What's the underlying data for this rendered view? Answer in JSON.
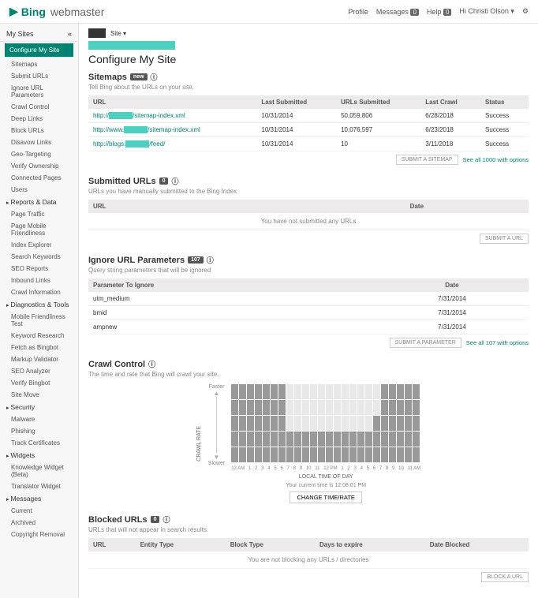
{
  "header": {
    "brand_a": "Bing",
    "brand_b": "webmaster",
    "profile": "Profile",
    "messages": "Messages",
    "messages_n": "0",
    "help": "Help",
    "help_n": "0",
    "user": "Hi Christi Olson ▾",
    "gear": "⚙"
  },
  "sidebar": {
    "head": "My Sites",
    "items": [
      {
        "l": "Configure My Site",
        "sel": true
      },
      {
        "l": "Sitemaps"
      },
      {
        "l": "Submit URLs"
      },
      {
        "l": "Ignore URL Parameters"
      },
      {
        "l": "Crawl Control"
      },
      {
        "l": "Deep Links"
      },
      {
        "l": "Block URLs"
      },
      {
        "l": "Disavow Links"
      },
      {
        "l": "Geo-Targeting"
      },
      {
        "l": "Verify Ownership"
      },
      {
        "l": "Connected Pages"
      },
      {
        "l": "Users"
      },
      {
        "l": "Reports & Data",
        "top": true,
        "arrow": true
      },
      {
        "l": "Page Traffic"
      },
      {
        "l": "Page Mobile Friendliness"
      },
      {
        "l": "Index Explorer"
      },
      {
        "l": "Search Keywords"
      },
      {
        "l": "SEO Reports"
      },
      {
        "l": "Inbound Links"
      },
      {
        "l": "Crawl Information"
      },
      {
        "l": "Diagnostics & Tools",
        "top": true,
        "arrow": true
      },
      {
        "l": "Mobile Friendliness Test"
      },
      {
        "l": "Keyword Research"
      },
      {
        "l": "Fetch as Bingbot"
      },
      {
        "l": "Markup Validator"
      },
      {
        "l": "SEO Analyzer"
      },
      {
        "l": "Verify Bingbot"
      },
      {
        "l": "Site Move"
      },
      {
        "l": "Security",
        "top": true,
        "arrow": true
      },
      {
        "l": "Malware"
      },
      {
        "l": "Phishing"
      },
      {
        "l": "Track Certificates"
      },
      {
        "l": "Widgets",
        "top": true,
        "arrow": true
      },
      {
        "l": "Knowledge Widget (Beta)"
      },
      {
        "l": "Translator Widget"
      },
      {
        "l": "Messages",
        "top": true,
        "arrow": true
      },
      {
        "l": "Current"
      },
      {
        "l": "Archived"
      },
      {
        "l": "Copyright Removal"
      }
    ]
  },
  "page": {
    "bc_site": "Site ▾",
    "title": "Configure My Site"
  },
  "sitemaps": {
    "title": "Sitemaps",
    "tag": "new",
    "sub": "Tell Bing about the URLs on your site.",
    "cols": [
      "URL",
      "Last Submitted",
      "URLs Submitted",
      "Last Crawl",
      "Status"
    ],
    "rows": [
      {
        "url": "http://▮▮▮▮▮▮▮▮/sitemap-index.xml",
        "ls": "10/31/2014",
        "us": "50,059,806",
        "lc": "6/28/2018",
        "st": "Success"
      },
      {
        "url": "http://www.▮▮▮▮▮▮▮▮/sitemap-index.xml",
        "ls": "10/31/2014",
        "us": "10,076,597",
        "lc": "6/23/2018",
        "st": "Success"
      },
      {
        "url": "http://blogs.▮▮▮▮▮▮▮▮/feed/",
        "ls": "10/31/2014",
        "us": "10",
        "lc": "3/11/2018",
        "st": "Success"
      }
    ],
    "btn": "SUBMIT A SITEMAP",
    "all": "See all 1000 with options"
  },
  "submitted": {
    "title": "Submitted URLs",
    "tag": "0",
    "sub": "URLs you have manually submitted to the Bing Index",
    "cols": [
      "URL",
      "Date"
    ],
    "empty": "You have not submitted any URLs",
    "btn": "SUBMIT A URL"
  },
  "params": {
    "title": "Ignore URL Parameters",
    "tag": "107",
    "sub": "Query string parameters that will be ignored",
    "cols": [
      "Parameter To Ignore",
      "Date"
    ],
    "rows": [
      {
        "p": "utm_medium",
        "d": "7/31/2014"
      },
      {
        "p": "bmid",
        "d": "7/31/2014"
      },
      {
        "p": "ampnew",
        "d": "7/31/2014"
      }
    ],
    "btn": "SUBMIT A PARAMETER",
    "all": "See all 107 with options"
  },
  "crawl": {
    "title": "Crawl Control",
    "sub": "The time and rate that Bing will crawl your site.",
    "fast": "Faster",
    "slow": "Slower",
    "ylabel": "CRAWL RATE",
    "xlabel": "LOCAL TIME OF DAY",
    "time_note": "Your current time is 12:08:01 PM",
    "btn": "CHANGE TIME/RATE"
  },
  "chart_data": {
    "type": "bar",
    "categories": [
      "12 AM",
      "1",
      "2",
      "3",
      "4",
      "5",
      "6",
      "7",
      "8",
      "9",
      "10",
      "11",
      "12 PM",
      "1",
      "2",
      "3",
      "4",
      "5",
      "6",
      "7",
      "8",
      "9",
      "10",
      "11 AM"
    ],
    "values": [
      5,
      5,
      5,
      5,
      5,
      5,
      5,
      2,
      2,
      2,
      2,
      2,
      2,
      2,
      2,
      2,
      2,
      2,
      3,
      5,
      5,
      5,
      5,
      5
    ],
    "ylabel": "Crawl Rate",
    "xlabel": "Local Time of Day",
    "ylim": [
      0,
      5
    ]
  },
  "blocked": {
    "title": "Blocked URLs",
    "tag": "0",
    "sub": "URLs that will not appear in search results.",
    "cols": [
      "URL",
      "Entity Type",
      "Block Type",
      "Days to expire",
      "Date Blocked"
    ],
    "empty": "You are not blocking any URLs / directories",
    "btn": "BLOCK A URL"
  }
}
